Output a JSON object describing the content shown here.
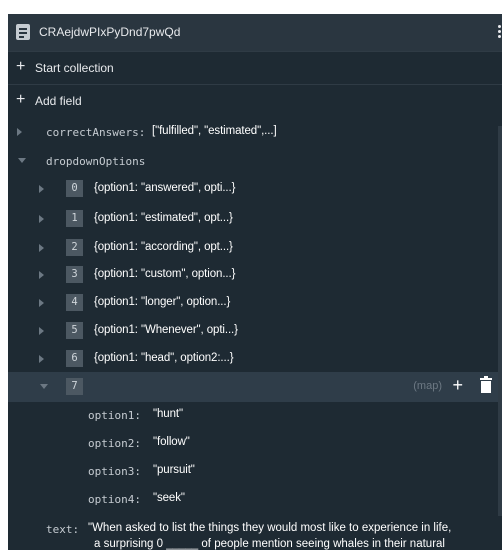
{
  "document": {
    "title": "CRAejdwPIxPyDnd7pwQd",
    "icon": "document-icon",
    "menu_icon": "kebab-menu-icon"
  },
  "actions": {
    "start_collection": "Start collection",
    "add_field": "Add field"
  },
  "fields": {
    "correctAnswers": {
      "key": "correctAnswers:",
      "preview": "[\"fulfilled\", \"estimated\",...]"
    },
    "dropdownOptions": {
      "key": "dropdownOptions",
      "items": [
        {
          "index": "0",
          "preview": "{option1: \"answered\", opti...}"
        },
        {
          "index": "1",
          "preview": "{option1: \"estimated\", opt...}"
        },
        {
          "index": "2",
          "preview": "{option1: \"according\", opt...}"
        },
        {
          "index": "3",
          "preview": "{option1: \"custom\", option...}"
        },
        {
          "index": "4",
          "preview": "{option1: \"longer\", option...}"
        },
        {
          "index": "5",
          "preview": "{option1: \"Whenever\", opti...}"
        },
        {
          "index": "6",
          "preview": "{option1: \"head\", option2:...}"
        }
      ],
      "expanded": {
        "index": "7",
        "type_label": "(map)",
        "options": [
          {
            "key": "option1:",
            "value": "\"hunt\""
          },
          {
            "key": "option2:",
            "value": "\"follow\""
          },
          {
            "key": "option3:",
            "value": "\"pursuit\""
          },
          {
            "key": "option4:",
            "value": "\"seek\""
          }
        ]
      }
    },
    "text": {
      "key": "text:",
      "line1": "\"When asked to list the things they would most like to experience in life,",
      "line2": "a surprising 0 _____ of people mention seeing whales in their natural"
    }
  },
  "colors": {
    "panel_bg": "#1e2a33",
    "header_bg": "#2a3640",
    "selected_row_bg": "#2f3d49",
    "index_badge_bg": "#4c5862"
  }
}
